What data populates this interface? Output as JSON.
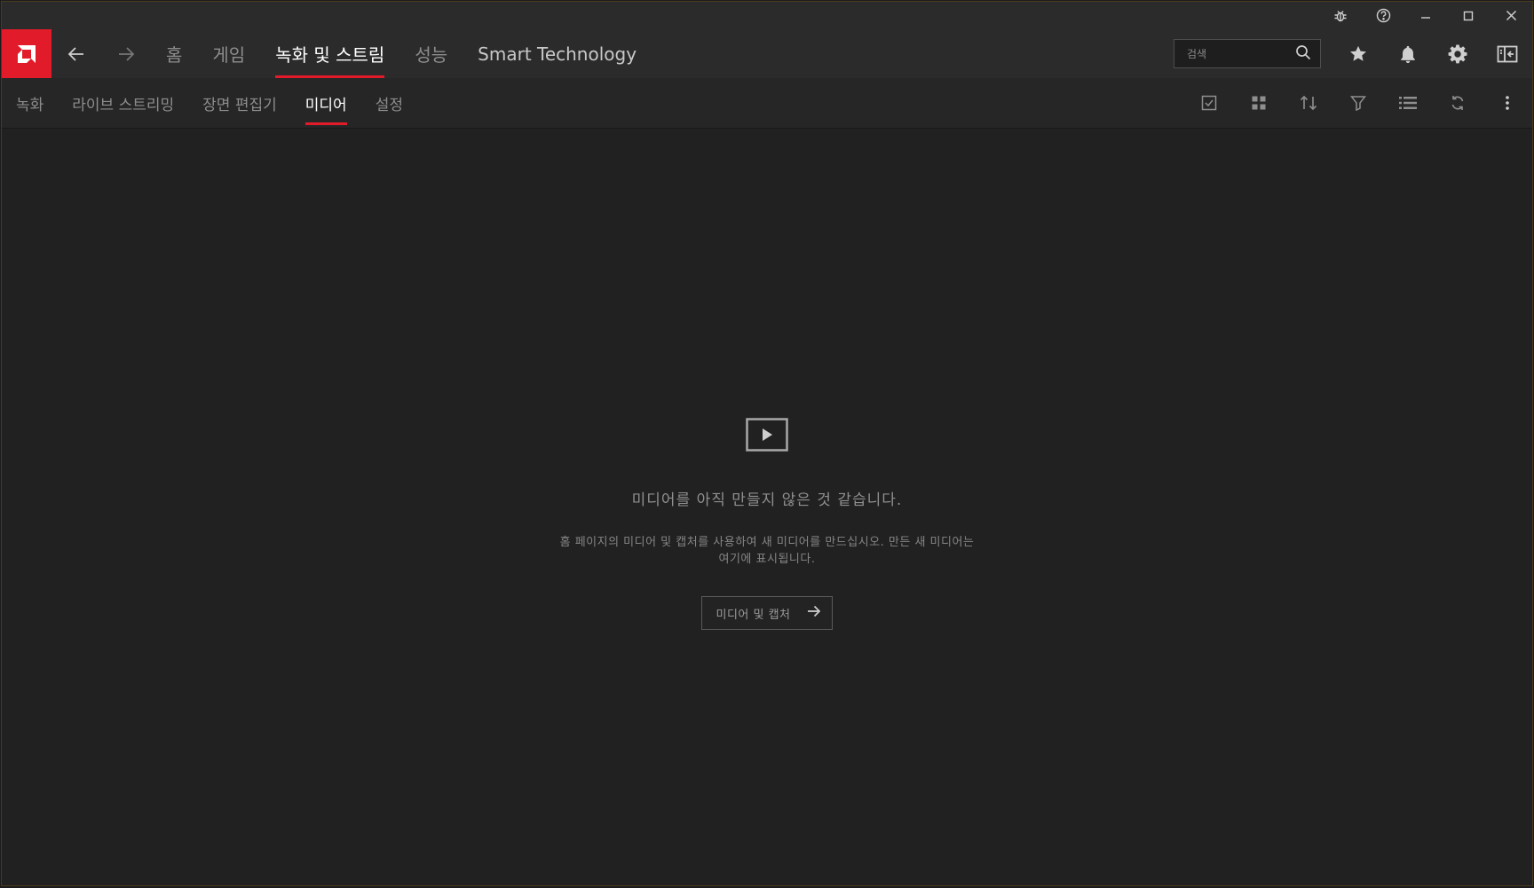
{
  "window": {
    "controls": [
      "bug-icon",
      "help-icon",
      "minimize-icon",
      "maximize-icon",
      "close-icon"
    ]
  },
  "mainnav": {
    "items": [
      {
        "label": "홈",
        "state": "normal"
      },
      {
        "label": "게임",
        "state": "normal"
      },
      {
        "label": "녹화 및 스트림",
        "state": "active"
      },
      {
        "label": "성능",
        "state": "normal"
      },
      {
        "label": "Smart Technology",
        "state": "light"
      }
    ],
    "search_placeholder": "검색",
    "right_icons": [
      "star-icon",
      "bell-icon",
      "gear-icon",
      "sidebar-toggle-icon"
    ]
  },
  "subnav": {
    "items": [
      {
        "label": "녹화",
        "state": "normal"
      },
      {
        "label": "라이브 스트리밍",
        "state": "normal"
      },
      {
        "label": "장면 편집기",
        "state": "normal"
      },
      {
        "label": "미디어",
        "state": "active"
      },
      {
        "label": "설정",
        "state": "normal"
      }
    ],
    "tools": [
      "select-checkbox-icon",
      "grid-view-icon",
      "sort-icon",
      "filter-icon",
      "list-view-icon",
      "refresh-icon",
      "more-vertical-icon"
    ]
  },
  "empty_state": {
    "icon": "media-play-icon",
    "title": "미디어를 아직 만들지 않은 것 같습니다.",
    "description": "홈 페이지의 미디어 및 캡처를 사용하여 새 미디어를 만드십시오. 만든 새 미디어는 여기에 표시됩니다.",
    "button_label": "미디어 및 캡처"
  },
  "colors": {
    "accent": "#e21b2a",
    "background": "#212121",
    "nav_background": "#2b2b2b"
  }
}
